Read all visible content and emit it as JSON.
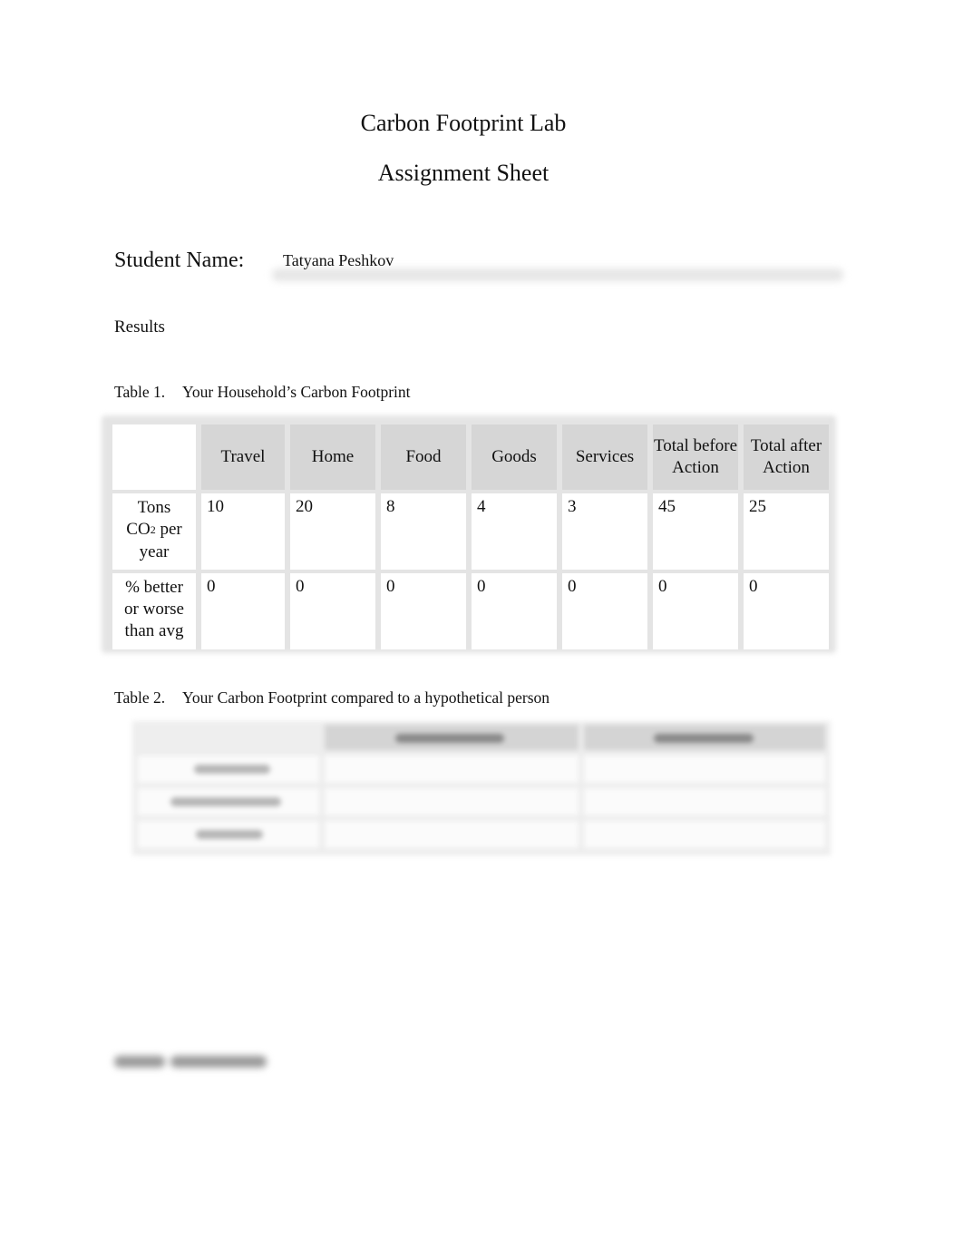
{
  "document": {
    "title_line1": "Carbon Footprint Lab",
    "title_line2": "Assignment Sheet",
    "student_name_label": "Student Name:",
    "student_name_value": "Tatyana Peshkov",
    "section_results": "Results"
  },
  "table1": {
    "caption_number": "Table 1.",
    "caption_text": "Your Household’s Carbon Footprint",
    "columns": [
      "Travel",
      "Home",
      "Food",
      "Goods",
      "Services",
      "Total before Action",
      "Total after Action"
    ],
    "rows": [
      {
        "label_part1": "Tons",
        "label_part2": "CO",
        "label_sub": "2",
        "label_part3": "per",
        "label_part4": "year",
        "values": [
          "10",
          "20",
          "8",
          "4",
          "3",
          "45",
          "25"
        ]
      },
      {
        "label_part1": "% better",
        "label_part2": "or worse",
        "label_part3": "than avg",
        "values": [
          "0",
          "0",
          "0",
          "0",
          "0",
          "0",
          "0"
        ]
      }
    ]
  },
  "table2": {
    "caption_number": "Table 2.",
    "caption_text": "Your Carbon Footprint compared to a hypothetical person",
    "content_obscured": true
  },
  "bottom_section": {
    "heading_obscured": true
  }
}
